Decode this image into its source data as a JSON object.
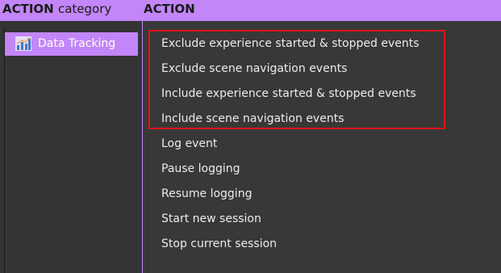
{
  "header": {
    "category_title_bold": "ACTION",
    "category_title_rest": "category",
    "action_title": "ACTION"
  },
  "categories": [
    {
      "label": "Data Tracking",
      "icon": "bar-chart-icon",
      "selected": true
    }
  ],
  "actions": [
    {
      "label": "Exclude experience started & stopped events",
      "highlighted": true
    },
    {
      "label": "Exclude scene navigation events",
      "highlighted": true
    },
    {
      "label": "Include experience started & stopped events",
      "highlighted": true
    },
    {
      "label": "Include scene navigation events",
      "highlighted": true
    },
    {
      "label": "Log event",
      "highlighted": false
    },
    {
      "label": "Pause logging",
      "highlighted": false
    },
    {
      "label": "Resume logging",
      "highlighted": false
    },
    {
      "label": "Start new session",
      "highlighted": false
    },
    {
      "label": "Stop current session",
      "highlighted": false
    }
  ],
  "colors": {
    "accent": "#c286f9",
    "highlight_border": "#e0121a",
    "panel_left": "#343434",
    "panel_right": "#383838",
    "text": "#ececec"
  }
}
